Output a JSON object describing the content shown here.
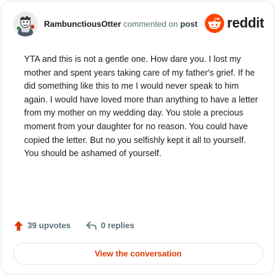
{
  "comment": {
    "author": "RambunctiousOtter",
    "action_text": "commented on",
    "post_link_text": "post",
    "body": "YTA and this is not a gentle one. How dare you. I lost my mother and spent years taking care of my father's grief. If he did something like this to me I would never speak to him again. I would have loved more than anything to have a letter from my mother on my wedding day. You stole a precious moment from your daughter for no reason. You could have copied the letter. But no you selfishly kept it all to yourself. You should be ashamed of yourself."
  },
  "brand": {
    "name": "reddit",
    "color": "#ff4500"
  },
  "stats": {
    "upvotes": "39 upvotes",
    "replies": "0 replies"
  },
  "cta": {
    "label": "View the conversation",
    "color": "#d93a00"
  },
  "icons": {
    "avatar": "user-avatar",
    "logo": "reddit-snoo-icon",
    "upvote": "upvote-arrow-icon",
    "reply": "reply-arrow-icon"
  }
}
